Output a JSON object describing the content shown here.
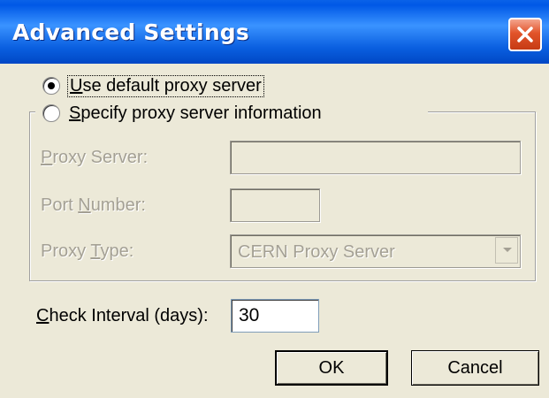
{
  "window": {
    "title": "Advanced Settings"
  },
  "proxy_mode": {
    "use_default_label": "Use default proxy server",
    "use_default_selected": true,
    "specify_label": "Specify proxy server information",
    "specify_selected": false
  },
  "proxy_group": {
    "server_label": "Proxy Server:",
    "server_value": "",
    "port_label": "Port Number:",
    "port_value": "",
    "type_label": "Proxy Type:",
    "type_value": "CERN Proxy Server"
  },
  "interval": {
    "label": "Check Interval (days):",
    "value": "30"
  },
  "buttons": {
    "ok": "OK",
    "cancel": "Cancel"
  }
}
